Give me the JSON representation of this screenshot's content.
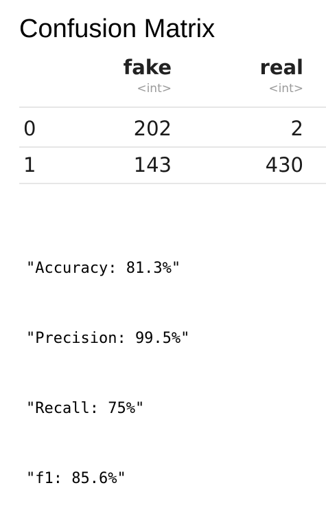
{
  "title": "Confusion Matrix",
  "chart_data": {
    "type": "table",
    "title": "Confusion Matrix",
    "columns": [
      {
        "name": "fake",
        "dtype": "<int>"
      },
      {
        "name": "real",
        "dtype": "<int>"
      }
    ],
    "rows": [
      {
        "label": "0",
        "values": [
          202,
          2
        ]
      },
      {
        "label": "1",
        "values": [
          143,
          430
        ]
      }
    ]
  },
  "metrics": [
    "\"Accuracy: 81.3%\"",
    "\"Precision: 99.5%\"",
    "\"Recall: 75%\"",
    "\"f1: 85.6%\""
  ]
}
